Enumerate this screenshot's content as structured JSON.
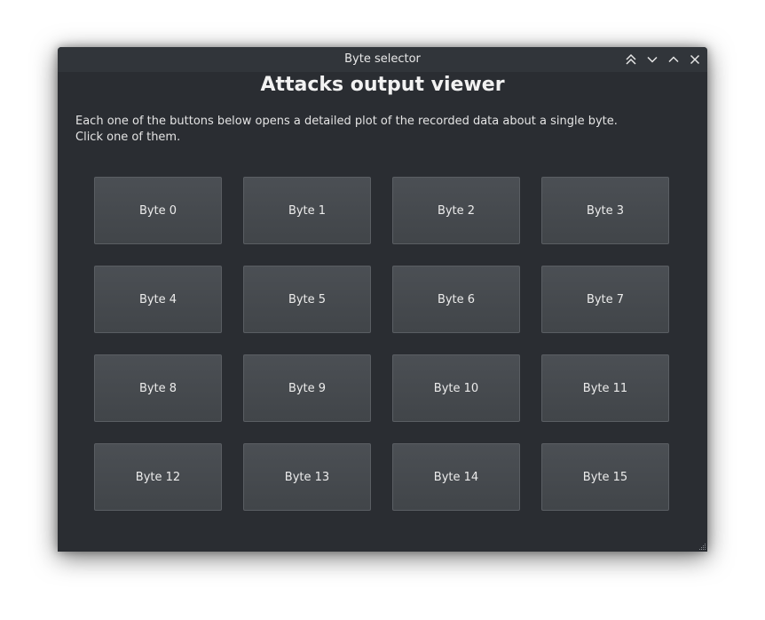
{
  "window": {
    "title": "Byte selector"
  },
  "main": {
    "heading": "Attacks output viewer",
    "description_line1": "Each one of the buttons below opens a detailed plot of the recorded data about a single byte.",
    "description_line2": "Click one of them."
  },
  "buttons": [
    "Byte 0",
    "Byte 1",
    "Byte 2",
    "Byte 3",
    "Byte 4",
    "Byte 5",
    "Byte 6",
    "Byte 7",
    "Byte 8",
    "Byte 9",
    "Byte 10",
    "Byte 11",
    "Byte 12",
    "Byte 13",
    "Byte 14",
    "Byte 15"
  ],
  "icons": {
    "keep_above": "double-chevron-up-icon",
    "minimize": "chevron-down-icon",
    "maximize": "chevron-up-icon",
    "close": "close-icon",
    "resize": "resize-grip-icon"
  }
}
